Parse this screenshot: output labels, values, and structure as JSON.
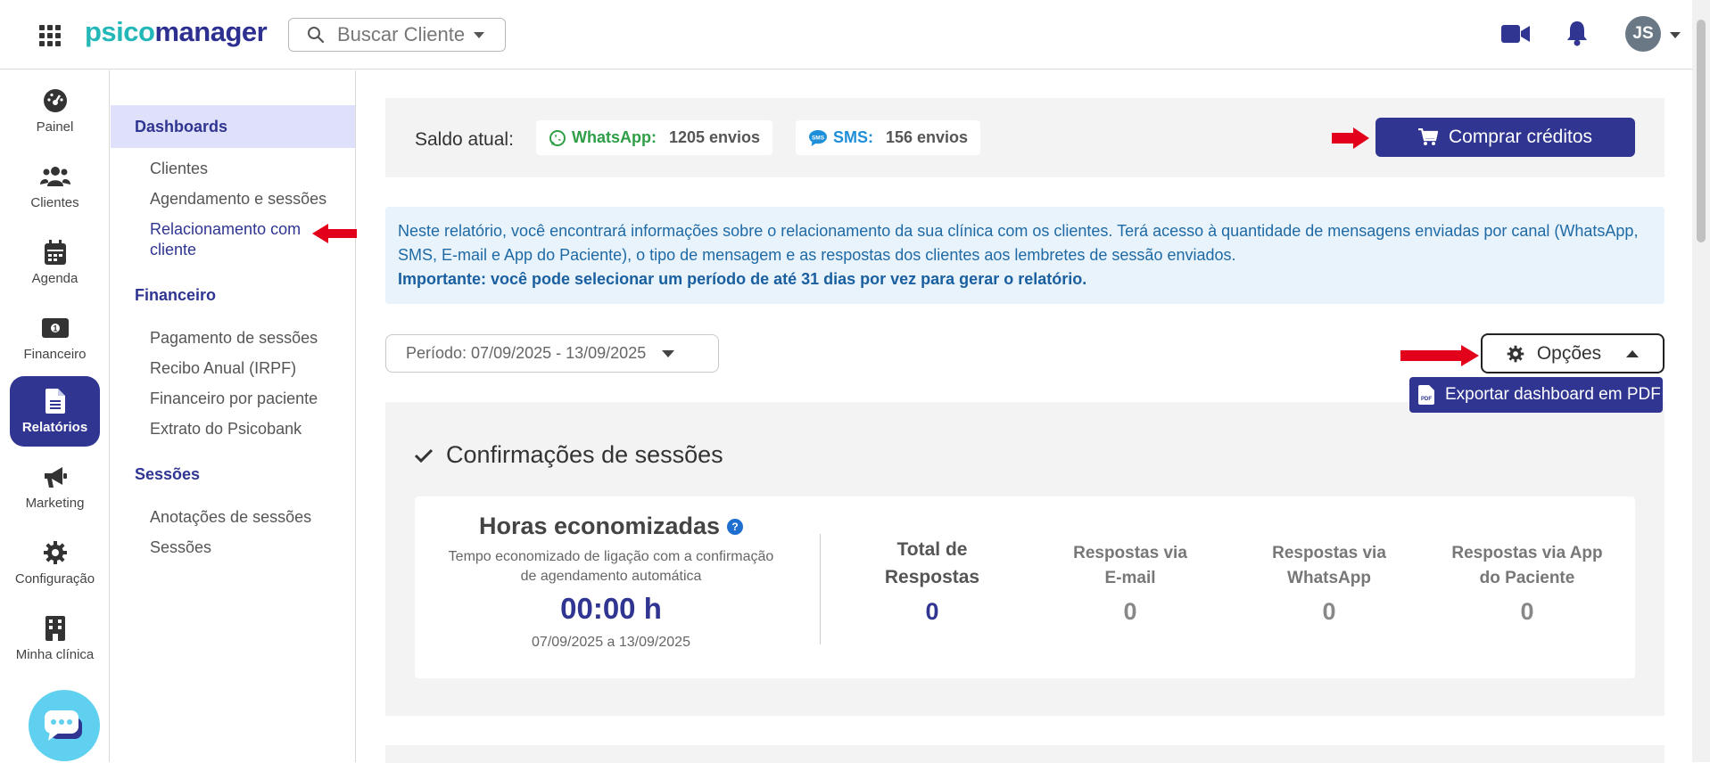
{
  "header": {
    "logo_part1": "psico",
    "logo_part2": "manager",
    "search_placeholder": "Buscar Cliente",
    "avatar_initials": "JS"
  },
  "rail": {
    "items": [
      {
        "label": "Painel",
        "icon": "gauge-icon"
      },
      {
        "label": "Clientes",
        "icon": "users-icon"
      },
      {
        "label": "Agenda",
        "icon": "calendar-icon"
      },
      {
        "label": "Financeiro",
        "icon": "money-icon"
      },
      {
        "label": "Relatórios",
        "icon": "file-icon",
        "active": true
      },
      {
        "label": "Marketing",
        "icon": "megaphone-icon"
      },
      {
        "label": "Configuração",
        "icon": "gear-icon"
      },
      {
        "label": "Minha clínica",
        "icon": "building-icon"
      }
    ]
  },
  "submenu": {
    "dashboards": "Dashboards",
    "dash_items": [
      "Clientes",
      "Agendamento e sessões",
      "Relacionamento com",
      "cliente"
    ],
    "financeiro": "Financeiro",
    "fin_items": [
      "Pagamento de sessões",
      "Recibo Anual (IRPF)",
      "Financeiro por paciente",
      "Extrato do Psicobank"
    ],
    "sessoes": "Sessões",
    "ses_items": [
      "Anotações de sessões",
      "Sessões"
    ]
  },
  "credits": {
    "saldo_label": "Saldo atual:",
    "whatsapp_label": "WhatsApp:",
    "whatsapp_count": "1205 envios",
    "sms_label": "SMS:",
    "sms_count": "156 envios",
    "buy_label": "Comprar créditos"
  },
  "info": {
    "text": "Neste relatório, você encontrará informações sobre o relacionamento da sua clínica com os clientes. Terá acesso à quantidade de mensagens enviadas por canal (WhatsApp, SMS, E-mail e App do Paciente), o tipo de mensagem e as respostas dos clientes aos lembretes de sessão enviados.",
    "important": "Importante: você pode selecionar um período de até 31 dias por vez para gerar o relatório."
  },
  "period": {
    "label": "Período: 07/09/2025 - 13/09/2025"
  },
  "options": {
    "label": "Opções",
    "export_label": "Exportar dashboard em PDF"
  },
  "confirmations": {
    "title": "Confirmações de sessões",
    "hours_title": "Horas economizadas",
    "hours_desc_1": "Tempo economizado de ligação com a confirmação",
    "hours_desc_2": "de agendamento automática",
    "hours_value": "00:00 h",
    "hours_range": "07/09/2025 a 13/09/2025",
    "stats": [
      {
        "l1": "Total de",
        "l2": "Respostas",
        "value": "0"
      },
      {
        "l1": "Respostas via",
        "l2": "E-mail",
        "value": "0"
      },
      {
        "l1": "Respostas via",
        "l2": "WhatsApp",
        "value": "0"
      },
      {
        "l1": "Respostas via App",
        "l2": "do Paciente",
        "value": "0"
      }
    ]
  },
  "colors": {
    "primary": "#2f3591",
    "teal": "#24b7b8",
    "whatsapp": "#2e9e47",
    "sms": "#1e8fd8",
    "info_bg": "#e8f3fc",
    "arrow": "#e3001b"
  }
}
